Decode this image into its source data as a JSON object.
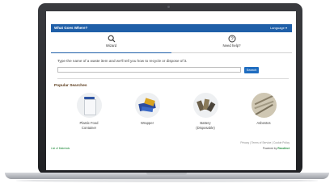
{
  "app": {
    "title": "What Goes Where?",
    "language": "Language"
  },
  "tabs": [
    {
      "label": "Wizard",
      "icon": "search-icon",
      "active": true
    },
    {
      "label": "Need help?",
      "icon": "help-icon",
      "active": false
    }
  ],
  "search": {
    "prompt": "Type the name of a waste item and we'll tell you how to recycle or dispose of it.",
    "placeholder": "",
    "button_label": "Search"
  },
  "popular": {
    "heading": "Popular Searches",
    "items": [
      {
        "name_line1": "Plastic Food",
        "name_line2": "Container",
        "icon": "plastic-container-image"
      },
      {
        "name_line1": "Wrapper",
        "name_line2": "",
        "icon": "wrapper-image"
      },
      {
        "name_line1": "Battery",
        "name_line2": "(Disposable)",
        "icon": "battery-image"
      },
      {
        "name_line1": "Asbestos",
        "name_line2": "",
        "icon": "asbestos-image"
      }
    ]
  },
  "footer": {
    "links": "Privacy | Terms of Service | Cookie Policy",
    "left": "List of Materials",
    "powered_prefix": "Powered by",
    "powered_brand": "Recollect"
  },
  "colors": {
    "brand": "#1f5fa8",
    "accent_green": "#1f8a3a"
  }
}
